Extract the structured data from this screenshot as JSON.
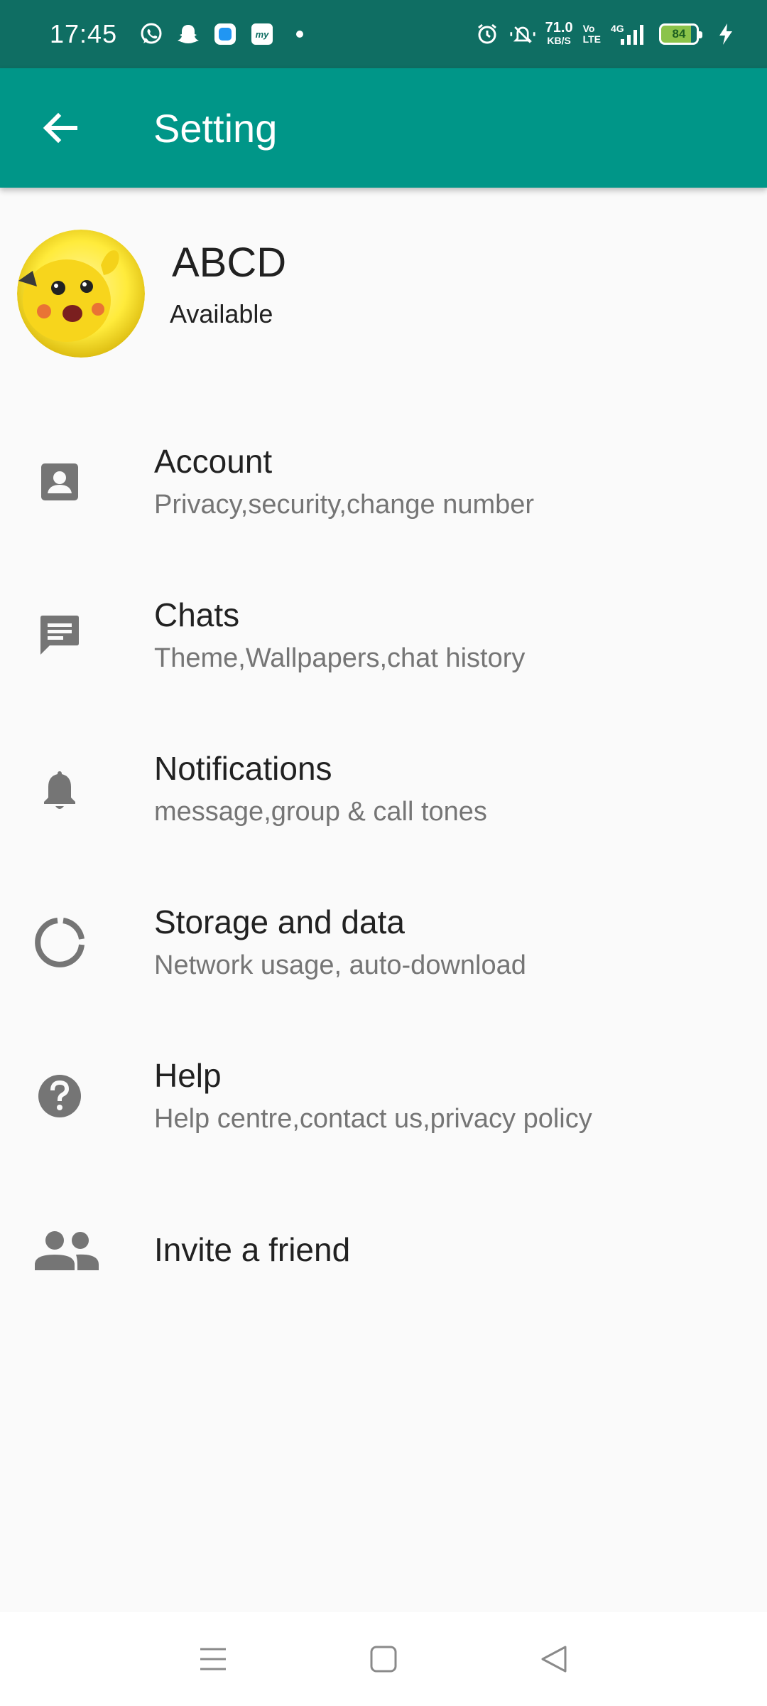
{
  "status_bar": {
    "time": "17:45",
    "speed_value": "71.0",
    "speed_unit": "KB/S",
    "volte_top": "Vo",
    "volte_bottom": "LTE",
    "network": "4G",
    "battery": "84",
    "icons": [
      "whatsapp-icon",
      "snapchat-icon",
      "app-icon",
      "myjio-icon",
      "dot-icon",
      "alarm-icon",
      "mute-icon",
      "signal-icon",
      "battery-icon",
      "charging-icon"
    ]
  },
  "app_bar": {
    "title": "Setting",
    "back_icon": "arrow-back-icon"
  },
  "profile": {
    "name": "ABCD",
    "status": "Available"
  },
  "settings": [
    {
      "icon": "account-icon",
      "title": "Account",
      "subtitle": "Privacy,security,change number"
    },
    {
      "icon": "chat-icon",
      "title": "Chats",
      "subtitle": "Theme,Wallpapers,chat history"
    },
    {
      "icon": "bell-icon",
      "title": "Notifications",
      "subtitle": "message,group & call tones"
    },
    {
      "icon": "storage-icon",
      "title": "Storage and data",
      "subtitle": "Network usage, auto-download"
    },
    {
      "icon": "help-icon",
      "title": "Help",
      "subtitle": "Help centre,contact us,privacy policy"
    },
    {
      "icon": "people-icon",
      "title": "Invite a friend",
      "subtitle": ""
    }
  ],
  "nav_bar": {
    "icons": [
      "menu-icon",
      "home-icon",
      "back-icon"
    ]
  },
  "colors": {
    "status_bar": "#0f6e63",
    "app_bar": "#009688",
    "icon_grey": "#757575",
    "background": "#fafafa"
  }
}
